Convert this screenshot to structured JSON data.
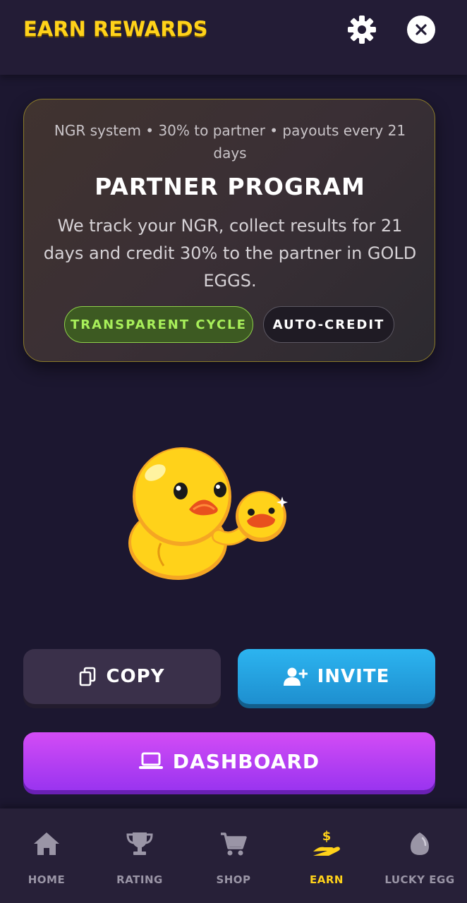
{
  "header": {
    "title": "EARN REWARDS",
    "settings_icon": "gear-icon",
    "close_icon": "close-icon"
  },
  "partner_card": {
    "subtitle": "NGR system • 30% to partner • payouts every 21 days",
    "title": "PARTNER PROGRAM",
    "description": "We track your NGR, collect results for 21 days and credit 30% to the partner in GOLD EGGS.",
    "badges": [
      {
        "label": "TRANSPARENT CYCLE",
        "color": "#a8ef5a"
      },
      {
        "label": "AUTO-CREDIT",
        "color": "#ffffff"
      }
    ]
  },
  "mascot": "duck-with-gold-egg-coin",
  "actions": {
    "copy_label": "COPY",
    "invite_label": "INVITE",
    "dashboard_label": "DASHBOARD"
  },
  "nav": {
    "items": [
      {
        "label": "HOME",
        "icon": "home-icon",
        "active": false
      },
      {
        "label": "RATING",
        "icon": "trophy-icon",
        "active": false
      },
      {
        "label": "SHOP",
        "icon": "cart-icon",
        "active": false
      },
      {
        "label": "EARN",
        "icon": "hand-dollar-icon",
        "active": true
      },
      {
        "label": "LUCKY EGG",
        "icon": "egg-icon",
        "active": false
      }
    ]
  },
  "colors": {
    "background": "#1c1730",
    "accent_yellow": "#ffd21a",
    "invite_blue": "#2cb4f0",
    "dashboard_purple": "#b040f2"
  }
}
